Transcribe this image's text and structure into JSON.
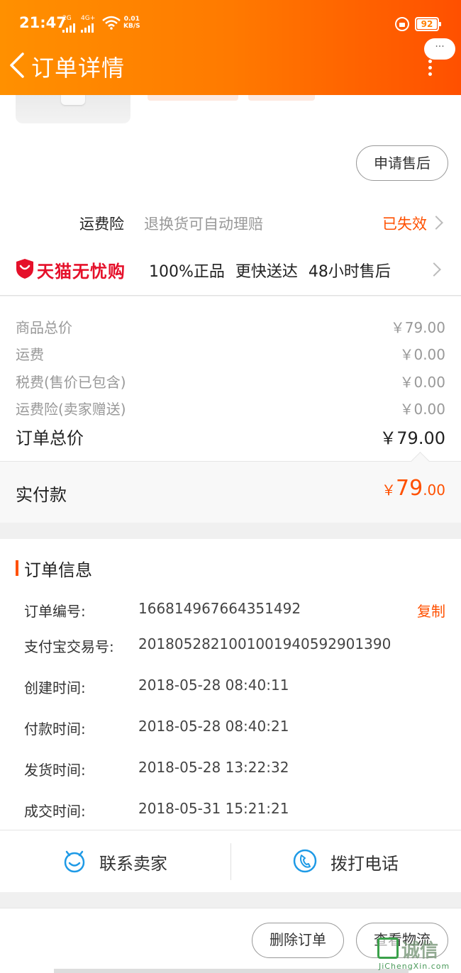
{
  "status_bar": {
    "time": "21:47",
    "signal_1": "2G",
    "signal_2": "4G+",
    "net_speed_value": "0.01",
    "net_speed_unit": "KB/S",
    "battery": "92"
  },
  "header": {
    "title": "订单详情",
    "bubble_text": "···"
  },
  "product": {
    "after_sale_button": "申请售后"
  },
  "freight_insurance": {
    "name": "运费险",
    "description": "退换货可自动理赔",
    "status": "已失效"
  },
  "tmall_guarantee": {
    "name": "天猫无忧购",
    "features": "100%正品 更快送达 48小时售后"
  },
  "price_summary": {
    "rows": [
      {
        "label": "商品总价",
        "value": "￥79.00"
      },
      {
        "label": "运费",
        "value": "￥0.00"
      },
      {
        "label": "税费(售价已包含)",
        "value": "￥0.00"
      },
      {
        "label": "运费险(卖家赠送)",
        "value": "￥0.00"
      }
    ],
    "total_label": "订单总价",
    "total_value": "￥79.00",
    "paid_label": "实付款",
    "paid_currency": "￥",
    "paid_integer": "79",
    "paid_decimal": ".00"
  },
  "order_info": {
    "title": "订单信息",
    "copy_label": "复制",
    "rows": [
      {
        "label": "订单编号:",
        "value": "166814967664351492"
      },
      {
        "label": "支付宝交易号:",
        "value": "2018052821001001940592901390"
      },
      {
        "label": "创建时间:",
        "value": "2018-05-28 08:40:11"
      },
      {
        "label": "付款时间:",
        "value": "2018-05-28 08:40:21"
      },
      {
        "label": "发货时间:",
        "value": "2018-05-28 13:22:32"
      },
      {
        "label": "成交时间:",
        "value": "2018-05-31 15:21:21"
      }
    ]
  },
  "contact": {
    "seller_label": "联系卖家",
    "phone_label": "拨打电话"
  },
  "actions": {
    "delete_label": "删除订单",
    "logistics_label": "查看物流"
  },
  "watermark": {
    "text": "诚信",
    "url_text": "JiChengXin.com"
  },
  "colors": {
    "accent": "#ff5000",
    "header_start": "#ff9000",
    "header_end": "#ff5000",
    "tmall_red": "#e5102a",
    "icon_blue": "#1e9ae6"
  }
}
